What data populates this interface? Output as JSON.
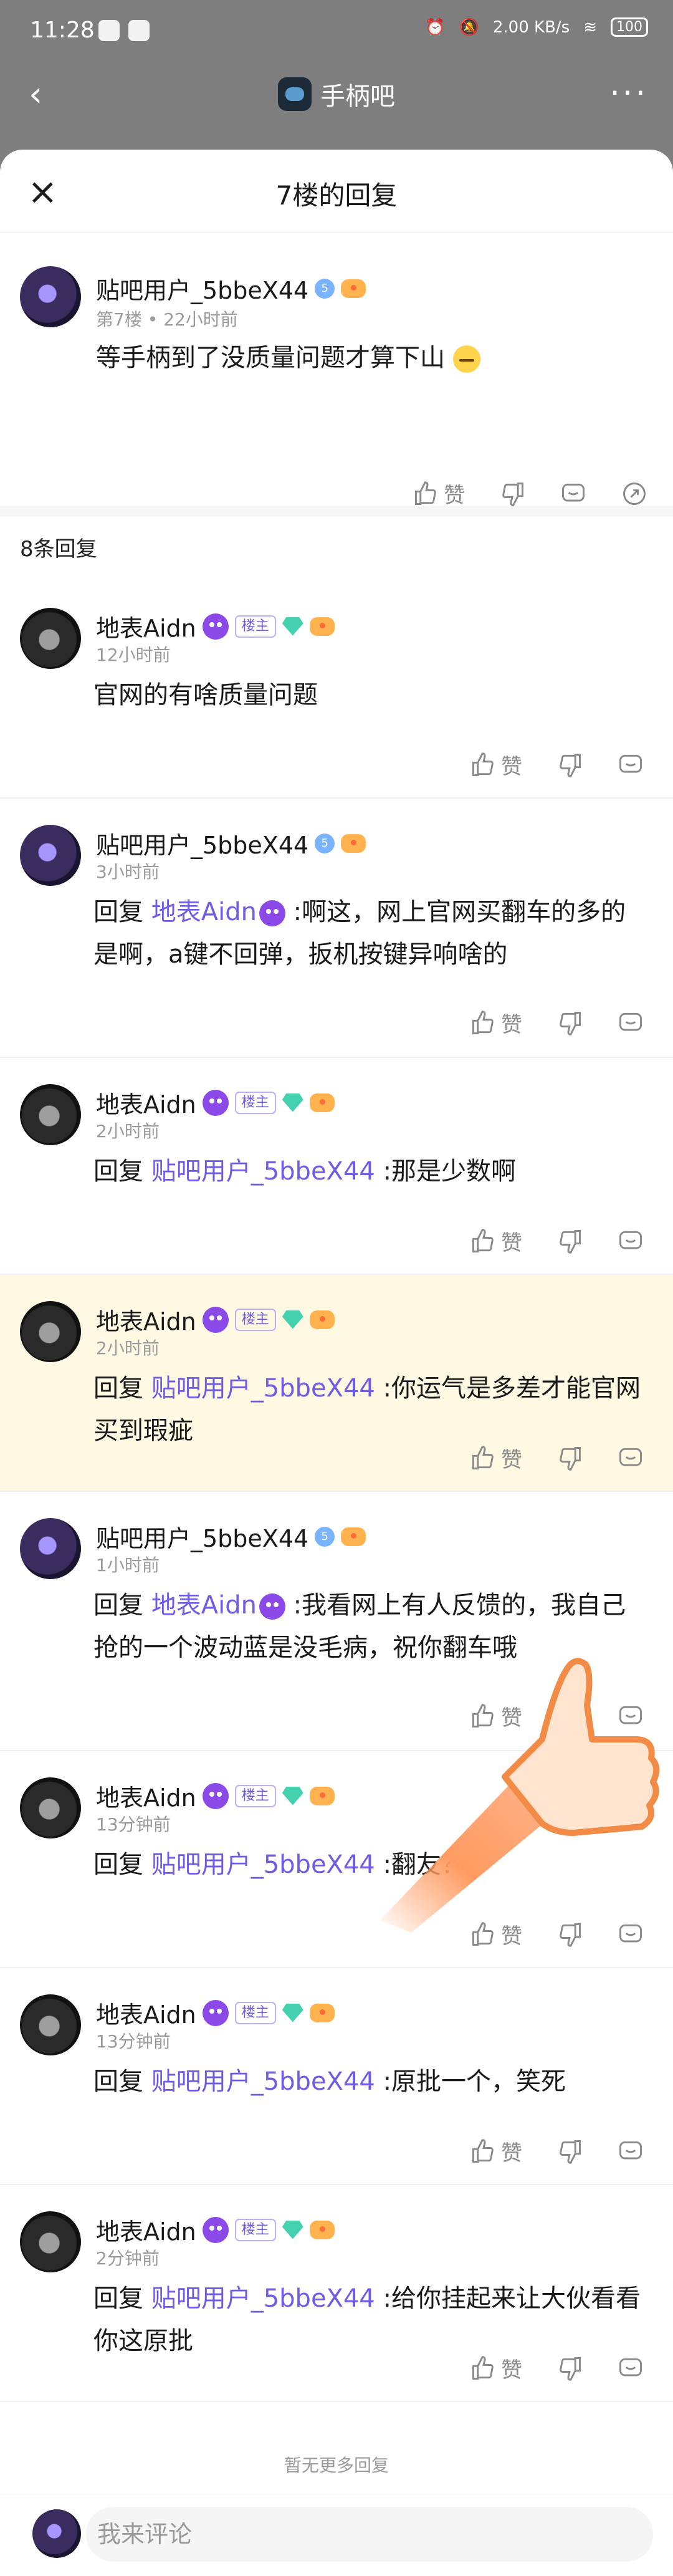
{
  "status_bar": {
    "time": "11:28",
    "indicators": [
      "alarm",
      "silent",
      "2.00 KB/s",
      "wifi",
      "100"
    ],
    "battery": "100"
  },
  "topbar": {
    "forum_name": "手柄吧",
    "back_icon": "chevron-left-icon",
    "more_icon": "more-dots-icon"
  },
  "sheet": {
    "title": "7楼的回复",
    "close_icon": "close-icon"
  },
  "main_post": {
    "user": "贴吧用户_5bbeX44",
    "floor": "第7楼",
    "time": "22小时前",
    "content": "等手柄到了没质量问题才算下山",
    "like_label": "赞"
  },
  "reply_count": "8条回复",
  "replies": [
    {
      "user": "地表Aidn",
      "is_host": true,
      "time": "12小时前",
      "content": "官网的有啥质量问题",
      "like": "赞"
    },
    {
      "user": "贴吧用户_5bbeX44",
      "is_host": false,
      "time": "3小时前",
      "reply_prefix": "回复",
      "target": "地表Aidn",
      "text": ":啊这，网上官网买翻车的多的是啊，a键不回弹，扳机按键异响啥的",
      "like": "赞"
    },
    {
      "user": "地表Aidn",
      "is_host": true,
      "time": "2小时前",
      "reply_prefix": "回复",
      "target": "贴吧用户_5bbeX44",
      "text": ":那是少数啊",
      "like": "赞"
    },
    {
      "user": "地表Aidn",
      "is_host": true,
      "time": "2小时前",
      "reply_prefix": "回复",
      "target": "贴吧用户_5bbeX44",
      "text": ":你运气是多差才能官网买到瑕疵",
      "like": "赞",
      "highlighted": true
    },
    {
      "user": "贴吧用户_5bbeX44",
      "is_host": false,
      "time": "1小时前",
      "reply_prefix": "回复",
      "target": "地表Aidn",
      "text": ":我看网上有人反馈的，我自己抢的一个波动蓝是没毛病，祝你翻车哦",
      "like": "赞"
    },
    {
      "user": "地表Aidn",
      "is_host": true,
      "time": "13分钟前",
      "reply_prefix": "回复",
      "target": "贴吧用户_5bbeX44",
      "text": ":翻友？",
      "like": "赞"
    },
    {
      "user": "地表Aidn",
      "is_host": true,
      "time": "13分钟前",
      "reply_prefix": "回复",
      "target": "贴吧用户_5bbeX44",
      "text": ":原批一个，笑死",
      "like": "赞"
    },
    {
      "user": "地表Aidn",
      "is_host": true,
      "time": "2分钟前",
      "reply_prefix": "回复",
      "target": "贴吧用户_5bbeX44",
      "text": ":给你挂起来让大伙看看你这原批",
      "like": "赞"
    }
  ],
  "host_badge": "楼主",
  "level_badge": "5",
  "end_note": "暂无更多回复",
  "comment_input": {
    "placeholder": "我来评论"
  },
  "colors": {
    "mention": "#6f5ce6",
    "highlight": "#fff8e2",
    "overlay": "#7e7e7e"
  }
}
